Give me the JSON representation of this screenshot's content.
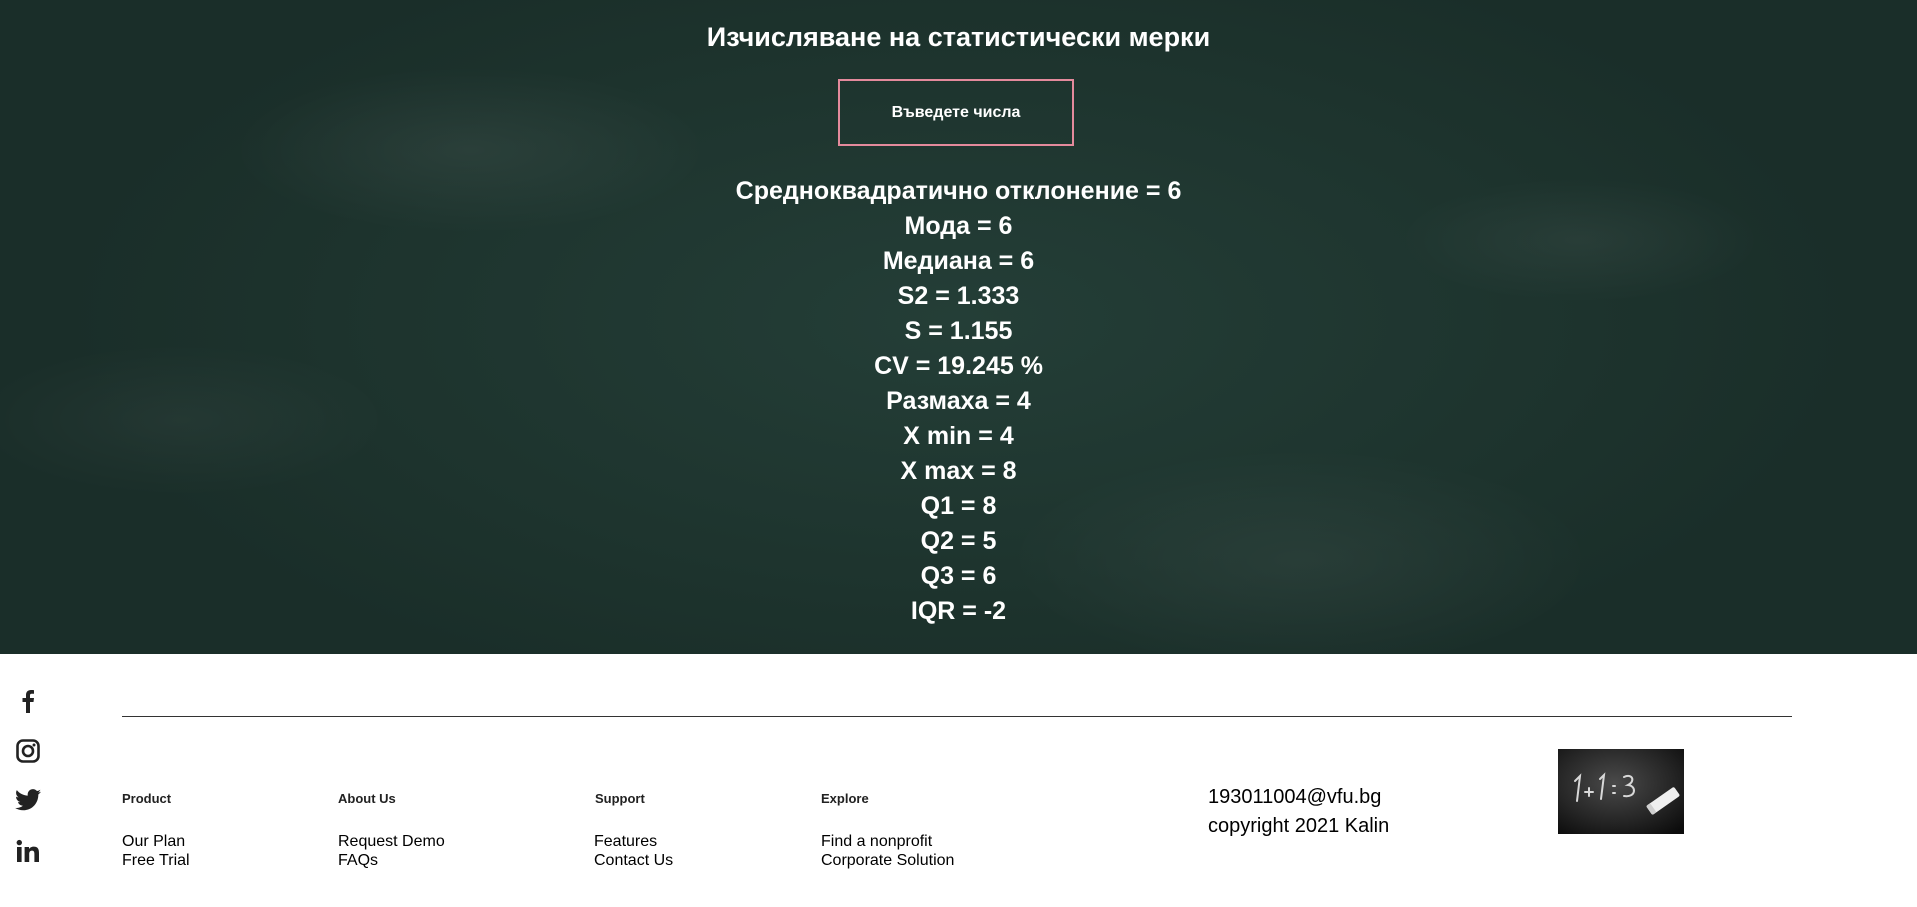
{
  "header": {
    "title": "Изчисляване на статистически мерки"
  },
  "actions": {
    "enter_numbers_label": "Въведете числа"
  },
  "results": [
    "Средноквадратично отклонение = 6",
    "Мода = 6",
    "Медиана = 6",
    "S2 = 1.333",
    "S = 1.155",
    "CV = 19.245 %",
    "Размаха = 4",
    "X min = 4",
    "X max = 8",
    "Q1 = 8",
    "Q2 = 5",
    "Q3 = 6",
    "IQR = -2"
  ],
  "social": [
    "facebook-icon",
    "instagram-icon",
    "twitter-icon",
    "linkedin-icon"
  ],
  "footer": {
    "columns": [
      {
        "heading": "Product",
        "links": [
          "Our Plan",
          "Free Trial"
        ]
      },
      {
        "heading": "About Us",
        "links": [
          "Request Demo",
          "FAQs"
        ]
      },
      {
        "heading": "Support",
        "links": [
          "Features",
          "Contact Us"
        ]
      },
      {
        "heading": "Explore",
        "links": [
          "Find a nonprofit",
          "Corporate Solution"
        ]
      }
    ],
    "email": "193011004@vfu.bg",
    "copyright": "copyright 2021 Kalin"
  },
  "colors": {
    "board": "#1f3630",
    "button_border": "#e48a9c",
    "text_light": "#ffffff",
    "text_dark": "#000000"
  }
}
